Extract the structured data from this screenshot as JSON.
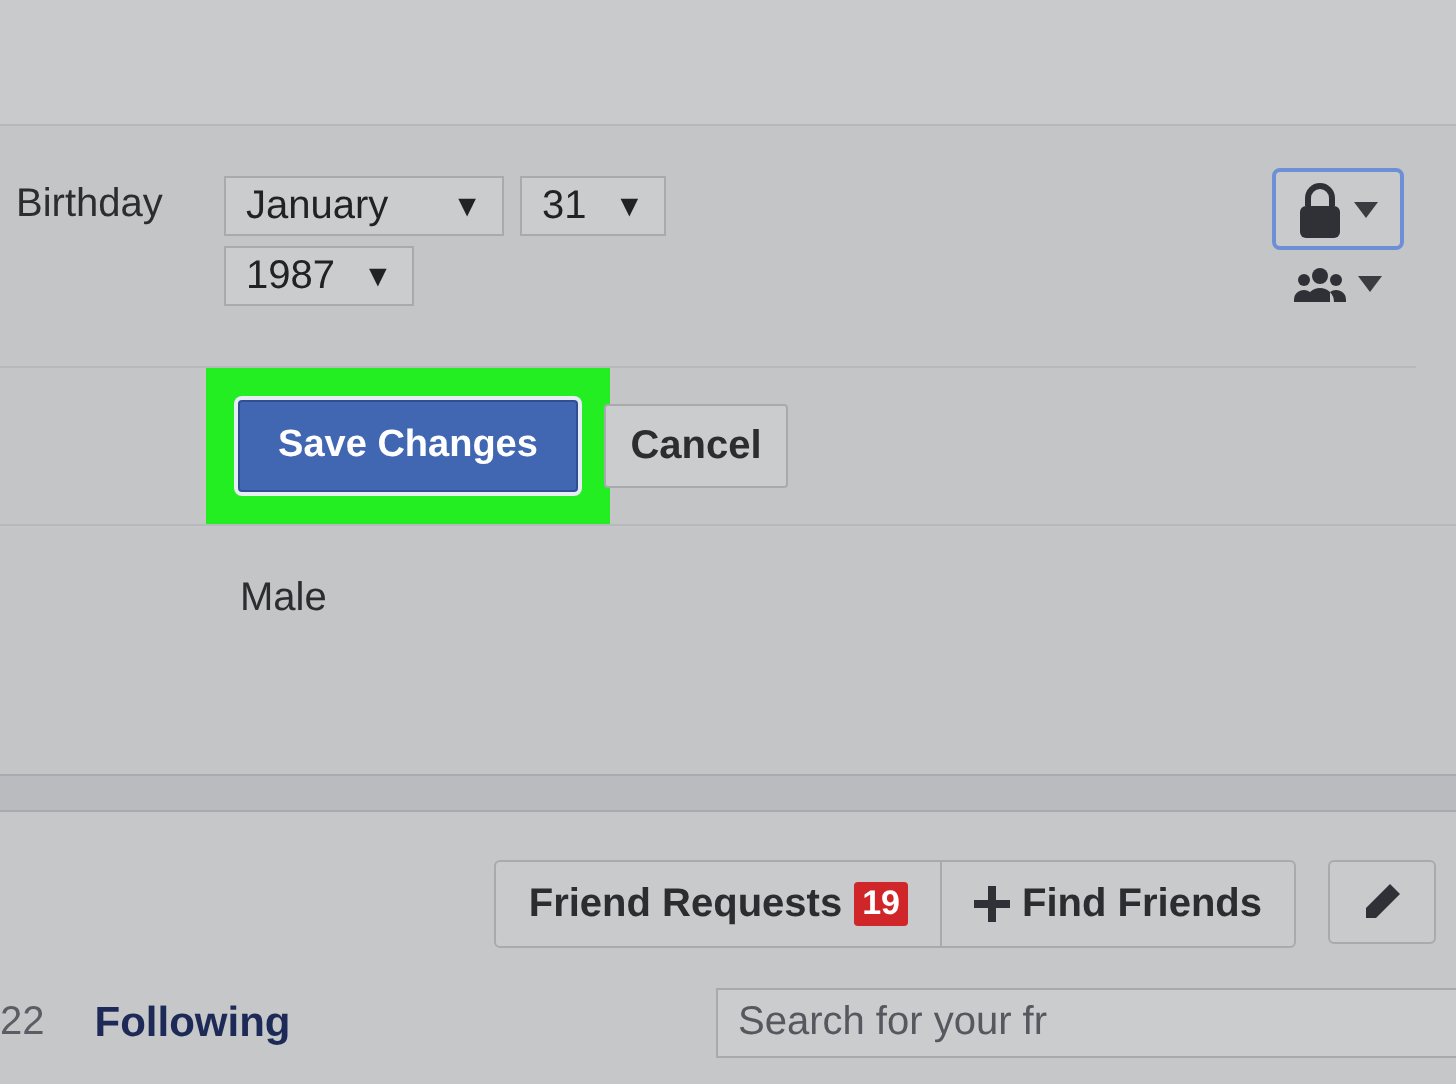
{
  "birthday": {
    "label": "Birthday",
    "selects": [
      {
        "value": "January",
        "arrow": "▼",
        "wide": true
      },
      {
        "value": "31",
        "arrow": "▼",
        "wide": false
      },
      {
        "value": "1987",
        "arrow": "▼",
        "wide": false
      }
    ],
    "privacy": {
      "focused": true
    }
  },
  "actions": {
    "save": {
      "label": "Save Changes",
      "highlighted": true
    },
    "cancel": {
      "label": "Cancel"
    }
  },
  "gender": {
    "value": "Male"
  },
  "profile_actions": {
    "friend_requests": {
      "label": "Friend Requests",
      "count": "19"
    },
    "find_friends": {
      "label": "Find Friends"
    }
  },
  "footer": {
    "count_fragment": "22",
    "following": "Following",
    "search": {
      "placeholder": "Search for your fr"
    }
  }
}
